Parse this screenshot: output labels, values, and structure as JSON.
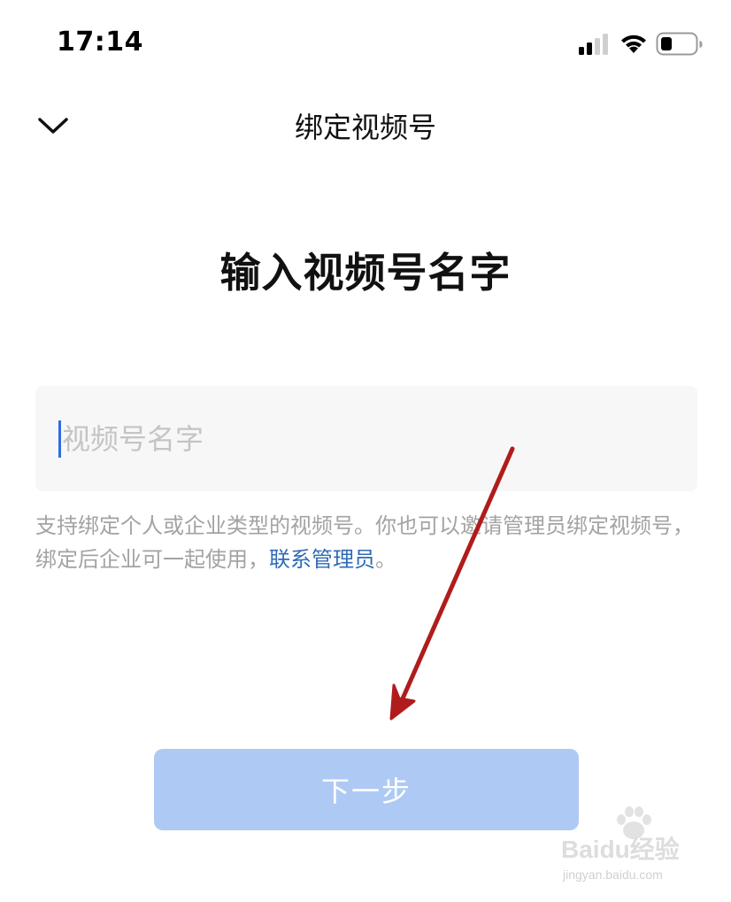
{
  "status_bar": {
    "time": "17:14",
    "icons": [
      "signal-icon",
      "wifi-icon",
      "battery-icon"
    ]
  },
  "nav": {
    "back_icon": "chevron-down-icon",
    "title": "绑定视频号"
  },
  "main": {
    "heading": "输入视频号名字",
    "input": {
      "value": "",
      "placeholder": "视频号名字"
    },
    "helper_text": "支持绑定个人或企业类型的视频号。你也可以邀请管理员绑定视频号，绑定后企业可一起使用，",
    "helper_link": "联系管理员",
    "helper_end": "。",
    "next_button": "下一步"
  },
  "watermark": {
    "brand": "Baidu经验",
    "url": "jingyan.baidu.com"
  },
  "colors": {
    "accent": "#2f6ce5",
    "link": "#2f6bb5",
    "button_disabled": "#aecaf4",
    "annotation_arrow": "#b01c1c"
  }
}
